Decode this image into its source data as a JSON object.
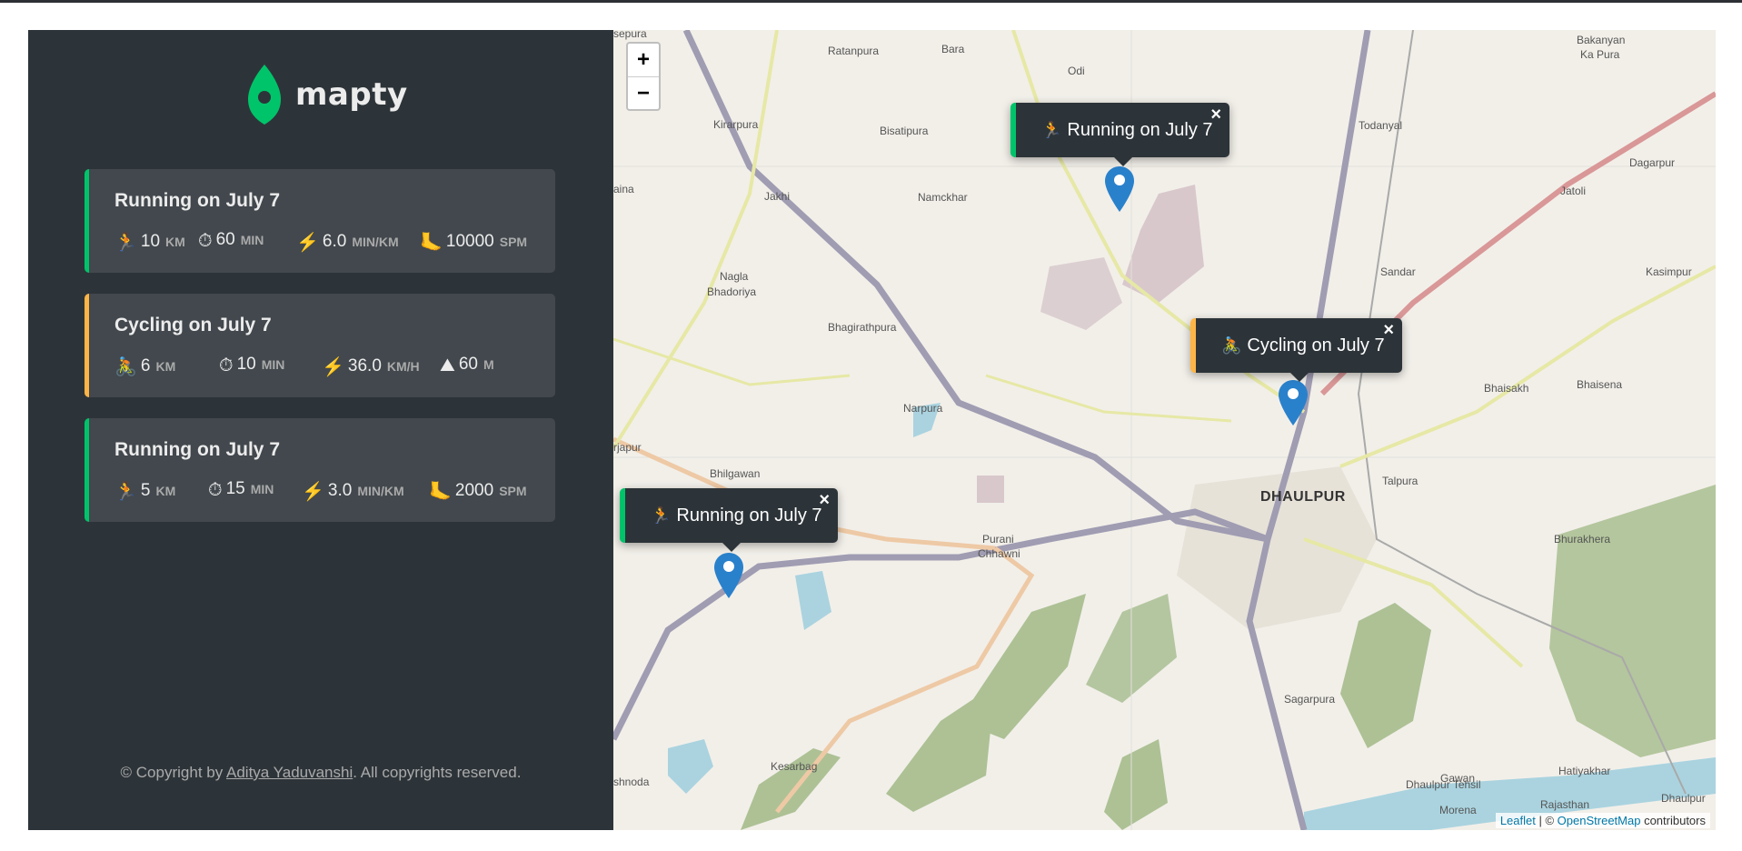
{
  "app": {
    "name": "mapty"
  },
  "colors": {
    "running": "#00c46a",
    "cycling": "#ffb545",
    "sidebar": "#2d3439",
    "card": "#42484d"
  },
  "workouts": [
    {
      "type": "running",
      "title": "Running on July 7",
      "details": [
        {
          "icon": "running-icon",
          "glyph": "🏃",
          "value": "10",
          "unit": "km"
        },
        {
          "icon": "stopwatch-icon",
          "glyph": "⏱",
          "value": "60",
          "unit": "min"
        },
        {
          "icon": "lightning-icon",
          "glyph": "⚡",
          "value": "6.0",
          "unit": "min/km"
        },
        {
          "icon": "foot-icon",
          "glyph": "🦶",
          "value": "10000",
          "unit": "spm"
        }
      ]
    },
    {
      "type": "cycling",
      "title": "Cycling on July 7",
      "details": [
        {
          "icon": "cycling-icon",
          "glyph": "🚴",
          "value": "6",
          "unit": "km"
        },
        {
          "icon": "stopwatch-icon",
          "glyph": "⏱",
          "value": "10",
          "unit": "min"
        },
        {
          "icon": "lightning-icon",
          "glyph": "⚡",
          "value": "36.0",
          "unit": "km/h"
        },
        {
          "icon": "mountain-icon",
          "glyph": "⛰",
          "value": "60",
          "unit": "m"
        }
      ]
    },
    {
      "type": "running",
      "title": "Running on July 7",
      "details": [
        {
          "icon": "running-icon",
          "glyph": "🏃",
          "value": "5",
          "unit": "km"
        },
        {
          "icon": "stopwatch-icon",
          "glyph": "⏱",
          "value": "15",
          "unit": "min"
        },
        {
          "icon": "lightning-icon",
          "glyph": "⚡",
          "value": "3.0",
          "unit": "min/km"
        },
        {
          "icon": "foot-icon",
          "glyph": "🦶",
          "value": "2000",
          "unit": "spm"
        }
      ]
    }
  ],
  "footer": {
    "prefix": "© Copyright by ",
    "author": "Aditya Yaduvanshi",
    "suffix": ". All copyrights reserved."
  },
  "map": {
    "zoom_in": "+",
    "zoom_out": "−",
    "popups": [
      {
        "type": "running",
        "icon": "running-icon",
        "glyph": "🏃",
        "label": "Running on July 7",
        "close": "×"
      },
      {
        "type": "cycling",
        "icon": "cycling-icon",
        "glyph": "🚴",
        "label": "Cycling on July 7",
        "close": "×"
      },
      {
        "type": "running",
        "icon": "running-icon",
        "glyph": "🏃",
        "label": "Running on July 7",
        "close": "×"
      }
    ],
    "places": {
      "dhaulpur": "DHAULPUR",
      "ratanpura": "Ratanpura",
      "bara": "Bara",
      "odi": "Odi",
      "bakanyan": "Bakanyan",
      "ka_pura": "Ka Pura",
      "kirarpura": "Kirarpura",
      "bisatipura": "Bisatipura",
      "todanyal": "Todanyal",
      "dagarpur": "Dagarpur",
      "jatoli": "Jatoli",
      "jakhi": "Jakhi",
      "namckhar": "Namckhar",
      "aina": "aina",
      "sandar": "Sandar",
      "kasimpur": "Kasimpur",
      "nagla": "Nagla",
      "bhadoriya": "Bhadoriya",
      "bhagirathpura": "Bhagirathpura",
      "bhaisakh": "Bhaisakh",
      "bhaisena": "Bhaisena",
      "narpura": "Narpura",
      "rjapur": "rjapur",
      "bhilgawan": "Bhilgawan",
      "talpura": "Talpura",
      "purani": "Purani",
      "chhawni": "Chhawni",
      "bhurakhera": "Bhurakhera",
      "sagarpura": "Sagarpura",
      "kesarbag": "Kesarbag",
      "shnoda": "shnoda",
      "hatiyakhar": "Hatiyakhar",
      "gawan": "Gawan",
      "dhaulpur_tehsil": "Dhaulpur Tehsil",
      "rajasthan": "Rajasthan",
      "dhaulpur_r": "Dhaulpur",
      "morena": "Morena",
      "sepura": "sepura"
    },
    "attribution": {
      "leaflet": "Leaflet",
      "sep": " | © ",
      "osm": "OpenStreetMap",
      "contributors": " contributors"
    }
  }
}
